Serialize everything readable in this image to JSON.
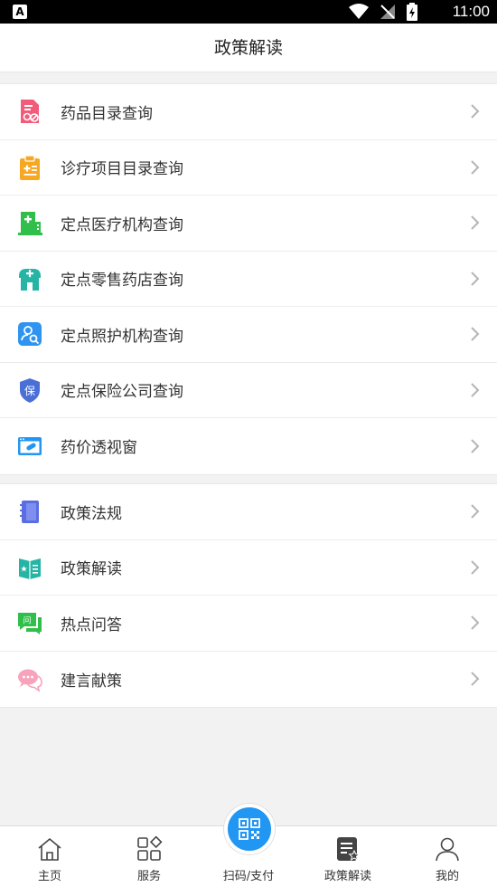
{
  "status_bar": {
    "time": "11:00",
    "badge": "A"
  },
  "title": "政策解读",
  "section1": [
    {
      "label": "药品目录查询",
      "icon": "medicine-list-icon"
    },
    {
      "label": "诊疗项目目录查询",
      "icon": "clipboard-medical-icon"
    },
    {
      "label": "定点医疗机构查询",
      "icon": "hospital-icon"
    },
    {
      "label": "定点零售药店查询",
      "icon": "pharmacy-icon"
    },
    {
      "label": "定点照护机构查询",
      "icon": "care-search-icon"
    },
    {
      "label": "定点保险公司查询",
      "icon": "insurance-shield-icon"
    },
    {
      "label": "药价透视窗",
      "icon": "price-window-icon"
    }
  ],
  "section2": [
    {
      "label": "政策法规",
      "icon": "notebook-icon"
    },
    {
      "label": "政策解读",
      "icon": "open-book-icon"
    },
    {
      "label": "热点问答",
      "icon": "qa-chat-icon"
    },
    {
      "label": "建言献策",
      "icon": "suggestion-chat-icon"
    }
  ],
  "tabs": [
    {
      "label": "主页",
      "icon": "home-icon"
    },
    {
      "label": "服务",
      "icon": "grid-icon"
    },
    {
      "label": "扫码/支付",
      "icon": "qr-scan-icon"
    },
    {
      "label": "政策解读",
      "icon": "policy-doc-icon"
    },
    {
      "label": "我的",
      "icon": "user-icon"
    }
  ],
  "colors": {
    "accent": "#2196f3",
    "background": "#f2f2f2"
  }
}
